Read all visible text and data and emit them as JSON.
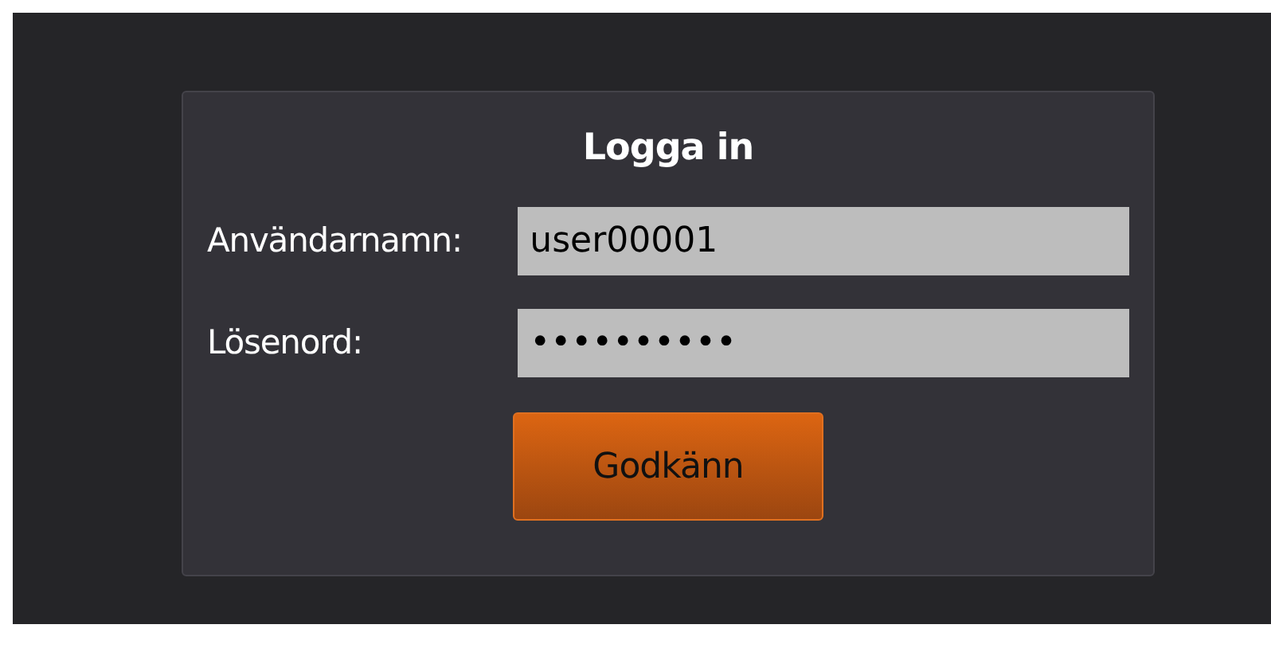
{
  "login": {
    "title": "Logga in",
    "fields": [
      {
        "label": "Användarnamn:",
        "value": "user00001"
      },
      {
        "label": "Lösenord:",
        "value": "••••••••••"
      }
    ],
    "submit": "Godkänn"
  }
}
